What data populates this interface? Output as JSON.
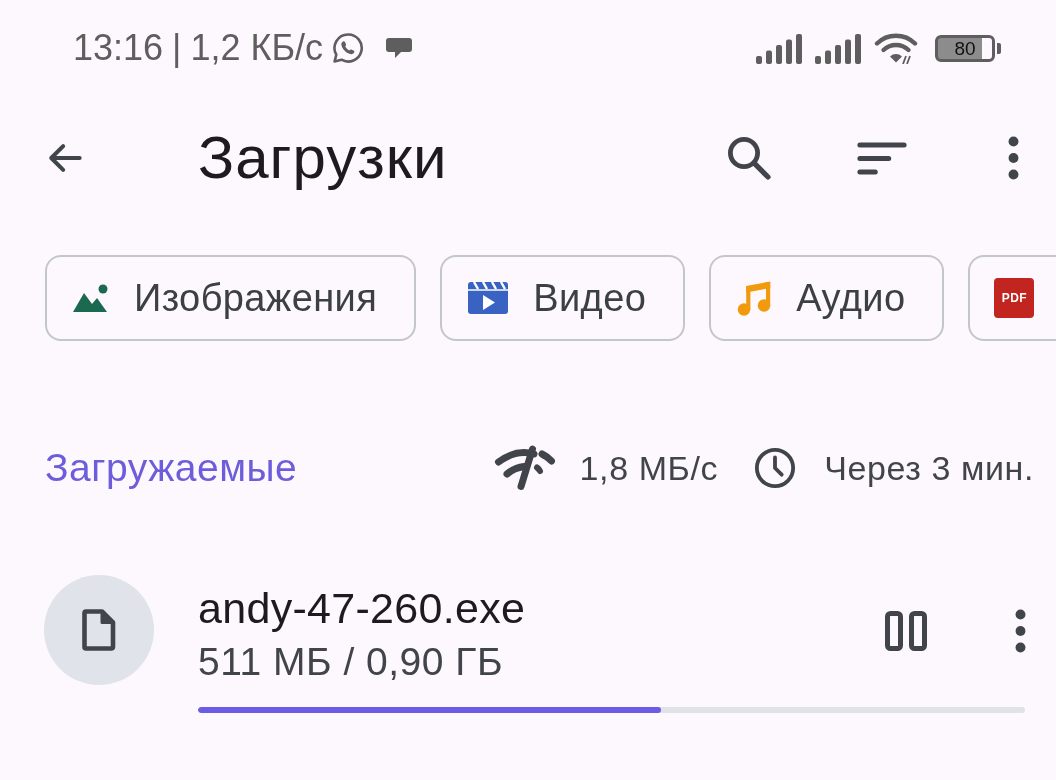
{
  "status_bar": {
    "time": "13:16",
    "separator": "|",
    "data_rate": "1,2 КБ/с",
    "battery": "80"
  },
  "app_bar": {
    "title": "Загрузки"
  },
  "filter_chips": [
    {
      "kind": "images",
      "label": "Изображения"
    },
    {
      "kind": "video",
      "label": "Видео"
    },
    {
      "kind": "audio",
      "label": "Аудио"
    },
    {
      "kind": "pdf",
      "icon_text": "PDF"
    }
  ],
  "section": {
    "title": "Загружаемые",
    "speed": "1,8 МБ/с",
    "time_left": "Через 3 мин."
  },
  "downloads": [
    {
      "name": "andy-47-260.exe",
      "size": "511 МБ / 0,90 ГБ",
      "level": 0.56
    }
  ]
}
